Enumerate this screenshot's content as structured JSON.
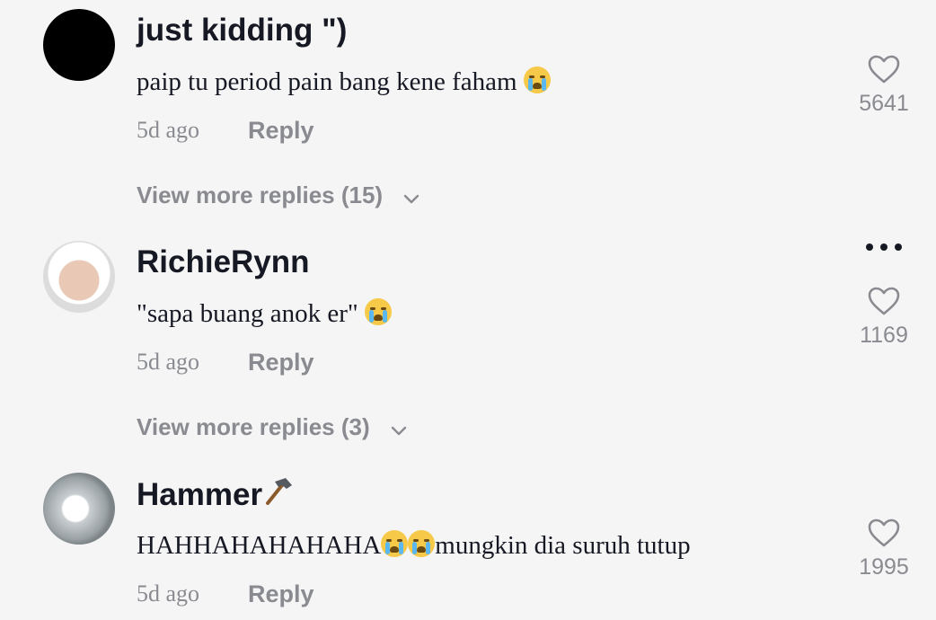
{
  "comments": [
    {
      "username": "just kidding \")",
      "text": "paip tu period pain bang kene faham",
      "emoji_count": 1,
      "time": "5d ago",
      "reply_label": "Reply",
      "view_more": "View more replies (15)",
      "likes": "5641",
      "avatar": "black-circle"
    },
    {
      "username": "RichieRynn",
      "text": "\"sapa buang anok er\"",
      "emoji_count": 1,
      "time": "5d ago",
      "reply_label": "Reply",
      "view_more": "View more replies (3)",
      "likes": "1169",
      "avatar": "photo-hijab"
    },
    {
      "username": "Hammer",
      "username_icon": "hammer-icon",
      "text_before": "HAHHAHAHAHAHA",
      "text_after": "mungkin dia suruh tutup",
      "emoji_count": 2,
      "time": "5d ago",
      "reply_label": "Reply",
      "likes": "1995",
      "avatar": "photo-blur"
    }
  ],
  "icons": {
    "like": "heart-outline-icon",
    "more": "more-options-icon",
    "expand": "chevron-down-icon",
    "emoji": "loudly-crying-face-emoji"
  },
  "colors": {
    "background": "#f5f5f5",
    "text_primary": "#161823",
    "text_secondary": "#8a8b91"
  }
}
